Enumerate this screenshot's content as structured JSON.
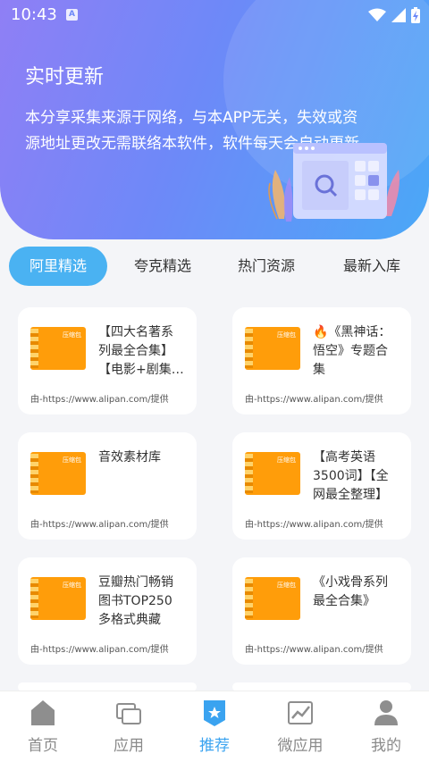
{
  "status_bar": {
    "time": "10:43",
    "notification_letter": "A"
  },
  "hero": {
    "title": "实时更新",
    "description": "本分享采集来源于网络，与本APP无关，失效或资源地址更改无需联络本软件，软件每天会自动更新"
  },
  "tabs": [
    {
      "label": "阿里精选",
      "active": true
    },
    {
      "label": "夸克精选",
      "active": false
    },
    {
      "label": "热门资源",
      "active": false
    },
    {
      "label": "最新入库",
      "active": false
    }
  ],
  "cards": [
    {
      "title": "【四大名著系列最全合集】【电影+剧集…",
      "source": "由-https://www.alipan.com/提供",
      "thumb_label": "压缩包"
    },
    {
      "title": "🔥《黑神话：悟空》专题合集",
      "source": "由-https://www.alipan.com/提供",
      "thumb_label": "压缩包"
    },
    {
      "title": "音效素材库",
      "source": "由-https://www.alipan.com/提供",
      "thumb_label": "压缩包"
    },
    {
      "title": "【高考英语3500词】【全网最全整理】",
      "source": "由-https://www.alipan.com/提供",
      "thumb_label": "压缩包"
    },
    {
      "title": "豆瓣热门畅销图书TOP250多格式典藏",
      "source": "由-https://www.alipan.com/提供",
      "thumb_label": "压缩包"
    },
    {
      "title": "《小戏骨系列最全合集》",
      "source": "由-https://www.alipan.com/提供",
      "thumb_label": "压缩包"
    }
  ],
  "nav": [
    {
      "label": "首页",
      "icon": "home-icon",
      "active": false
    },
    {
      "label": "应用",
      "icon": "apps-icon",
      "active": false
    },
    {
      "label": "推荐",
      "icon": "recommend-badge-icon",
      "active": true
    },
    {
      "label": "微应用",
      "icon": "chart-icon",
      "active": false
    },
    {
      "label": "我的",
      "icon": "user-icon",
      "active": false
    }
  ],
  "colors": {
    "accent": "#3aa3f0",
    "tab_active_bg": "#4ab2f2",
    "thumb": "#ff9d0a"
  }
}
